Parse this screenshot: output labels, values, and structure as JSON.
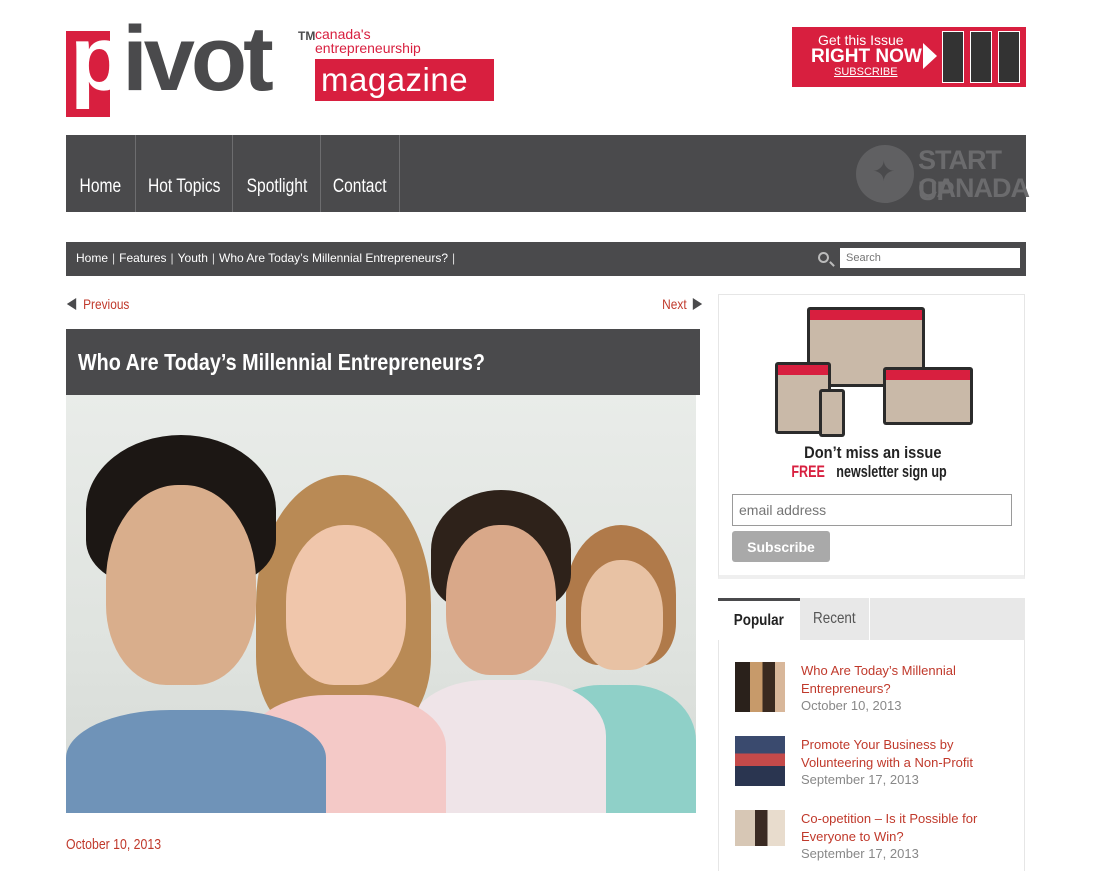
{
  "logo": {
    "word_p": "p",
    "word_rest": "ivot",
    "tm": "TM",
    "tagline_1": "canada's",
    "tagline_2": "entrepreneurship",
    "magazine": "magazine"
  },
  "promo": {
    "line1": "Get this Issue",
    "line2": "RIGHT NOW",
    "line3": "SUBSCRIBE"
  },
  "nav": {
    "items": [
      "Home",
      "Hot Topics",
      "Spotlight",
      "Contact"
    ],
    "partner_logo_line1": "START UP",
    "partner_logo_line2": "CANADA"
  },
  "breadcrumb": {
    "items": [
      "Home",
      "Features",
      "Youth",
      "Who Are Today’s Millennial Entrepreneurs?"
    ],
    "separator": "|"
  },
  "search": {
    "placeholder": "Search"
  },
  "pager": {
    "previous": "Previous",
    "next": "Next"
  },
  "article": {
    "title": "Who Are Today’s Millennial Entrepreneurs?",
    "date": "October 10, 2013"
  },
  "newsletter": {
    "heading1": "Don’t miss an issue",
    "heading2_free": "FREE",
    "heading2_rest": " newsletter sign up",
    "email_placeholder": "email address",
    "button": "Subscribe"
  },
  "tabs": {
    "popular": "Popular",
    "recent": "Recent"
  },
  "popular_posts": [
    {
      "title": "Who Are Today’s Millennial Entrepreneurs?",
      "date": "October 10, 2013"
    },
    {
      "title": "Promote Your Business by Volunteering with a Non-Profit",
      "date": "September 17, 2013"
    },
    {
      "title": "Co-opetition – Is it Possible for Everyone to Win?",
      "date": "September 17, 2013"
    }
  ],
  "colors": {
    "brand_red": "#d81f3f",
    "dark_gray": "#4a4a4c",
    "link_red": "#c0392b"
  }
}
